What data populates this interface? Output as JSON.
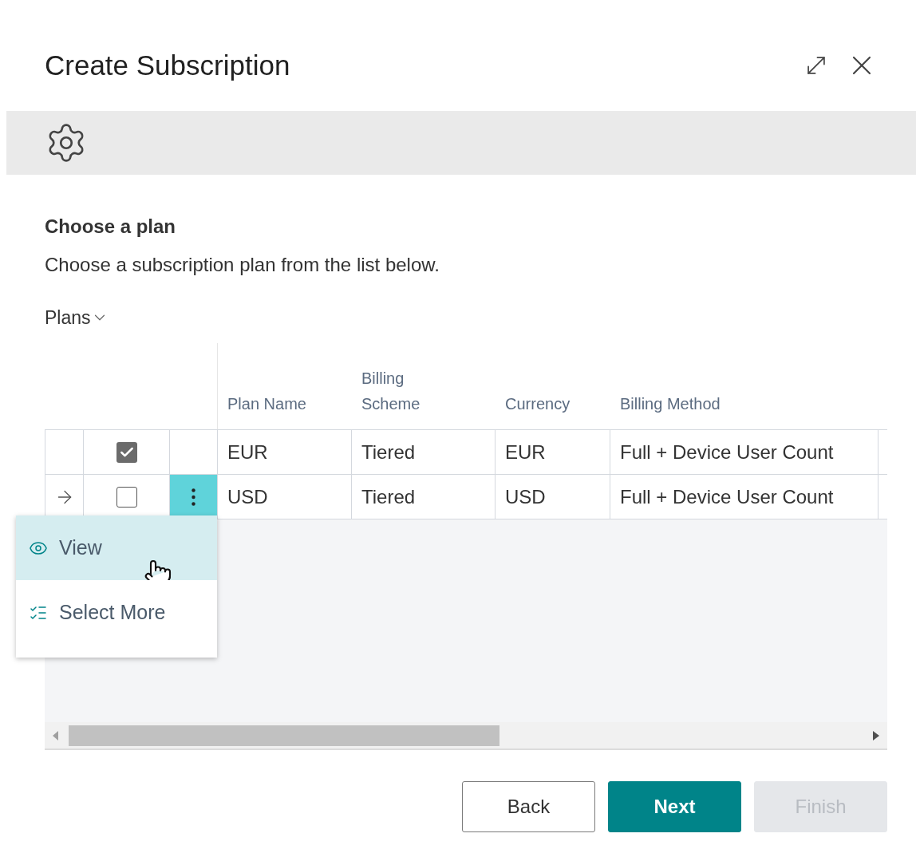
{
  "dialog": {
    "title": "Create Subscription"
  },
  "section": {
    "heading": "Choose a plan",
    "description": "Choose a subscription plan from the list below."
  },
  "plans": {
    "label": "Plans",
    "columns": [
      "Plan Name",
      "Billing Scheme",
      "Currency",
      "Billing Method"
    ],
    "rows": [
      {
        "current": false,
        "checked": true,
        "menu_open": false,
        "cells": [
          "EUR",
          "Tiered",
          "EUR",
          "Full + Device User Count"
        ]
      },
      {
        "current": true,
        "checked": false,
        "menu_open": true,
        "cells": [
          "USD",
          "Tiered",
          "USD",
          "Full + Device User Count"
        ]
      }
    ],
    "menu": [
      {
        "kind": "view",
        "label": "View",
        "selected": true
      },
      {
        "kind": "select_more",
        "label": "Select More",
        "selected": false
      }
    ]
  },
  "buttons": [
    {
      "kind": "secondary",
      "label": "Back",
      "disabled": false
    },
    {
      "kind": "primary",
      "label": "Next",
      "disabled": false
    },
    {
      "kind": "primary",
      "label": "Finish",
      "disabled": true
    }
  ]
}
